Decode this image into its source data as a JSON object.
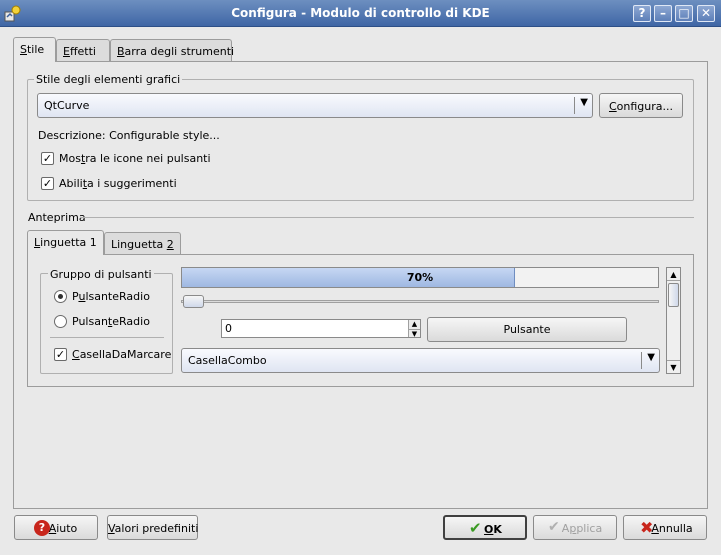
{
  "window": {
    "title": "Configura - Modulo di controllo di KDE",
    "buttons": {
      "help": "?",
      "minimize": "–",
      "maximize": "□",
      "close": "✕"
    }
  },
  "tabs": [
    {
      "pre": "",
      "u": "S",
      "post": "tile"
    },
    {
      "pre": "",
      "u": "E",
      "post": "ffetti"
    },
    {
      "pre": "",
      "u": "B",
      "post": "arra degli strumenti"
    }
  ],
  "style_group": {
    "legend": "Stile degli elementi grafici",
    "combo_value": "QtCurve",
    "configure_button": {
      "pre": "",
      "u": "C",
      "post": "onfigura..."
    },
    "description": "Descrizione: Configurable style...",
    "checkbox_icons": {
      "pre": "Mos",
      "u": "t",
      "post": "ra le icone nei pulsanti",
      "checked": true
    },
    "checkbox_tooltips": {
      "pre": "Abili",
      "u": "t",
      "post": "a i suggerimenti",
      "checked": true
    }
  },
  "preview": {
    "label": "Anteprima",
    "tabs": [
      {
        "pre": "",
        "u": "L",
        "post": "inguetta 1"
      },
      {
        "pre": "Linguetta ",
        "u": "2",
        "post": ""
      }
    ],
    "button_group": {
      "legend": "Gruppo di pulsanti",
      "radio1": {
        "pre": "P",
        "u": "u",
        "post": "lsanteRadio",
        "checked": true
      },
      "radio2": {
        "pre": "Pulsan",
        "u": "t",
        "post": "eRadio",
        "checked": false
      },
      "checkbox": {
        "pre": "",
        "u": "C",
        "post": "asellaDaMarcare",
        "checked": true
      }
    },
    "progress": {
      "value": 0.7,
      "label": "70%"
    },
    "slider_value": 0,
    "spinbox_value": "0",
    "push_button": "Pulsante",
    "combo_value": "CasellaCombo"
  },
  "footer": {
    "help": {
      "pre": "",
      "u": "A",
      "post": "iuto"
    },
    "defaults": {
      "pre": "",
      "u": "V",
      "post": "alori predefiniti"
    },
    "ok": {
      "pre": "",
      "u": "O",
      "post": "K"
    },
    "apply": {
      "pre": "A",
      "u": "p",
      "post": "plica"
    },
    "cancel": {
      "pre": "",
      "u": "A",
      "post": "nnulla"
    }
  },
  "colors": {
    "titlebar": "#4f75b3",
    "progress_fill": "#a9c1e8",
    "ok_icon": "#3a9a22",
    "help_icon": "#c8261c",
    "cancel_icon": "#c8261c"
  }
}
